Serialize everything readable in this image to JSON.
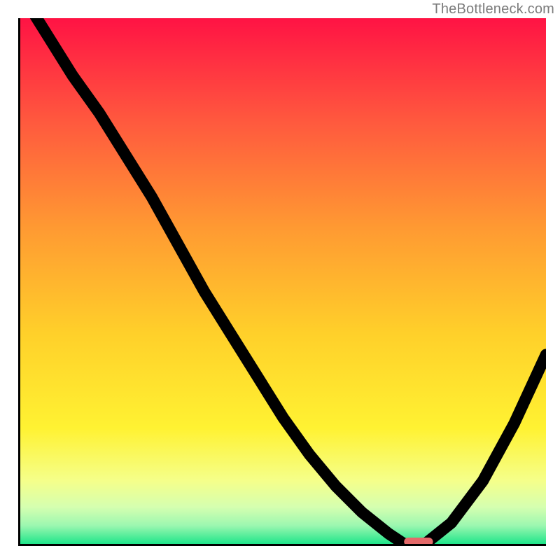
{
  "watermark": "TheBottleneck.com",
  "colors": {
    "axis": "#000000",
    "curve": "#000000",
    "marker": "#e56a6a",
    "gradient_stops": [
      {
        "offset": 0.0,
        "color": "#ff1344"
      },
      {
        "offset": 0.2,
        "color": "#ff5a3e"
      },
      {
        "offset": 0.4,
        "color": "#ff9a32"
      },
      {
        "offset": 0.6,
        "color": "#ffd02a"
      },
      {
        "offset": 0.78,
        "color": "#fff232"
      },
      {
        "offset": 0.88,
        "color": "#f5ff8a"
      },
      {
        "offset": 0.93,
        "color": "#d5ffb0"
      },
      {
        "offset": 0.965,
        "color": "#9cf7b0"
      },
      {
        "offset": 1.0,
        "color": "#1fe58a"
      }
    ]
  },
  "chart_data": {
    "type": "line",
    "title": "",
    "xlabel": "",
    "ylabel": "",
    "xlim": [
      0,
      100
    ],
    "ylim": [
      0,
      100
    ],
    "x": [
      0,
      5,
      10,
      15,
      20,
      25,
      30,
      35,
      40,
      45,
      50,
      55,
      60,
      65,
      70,
      73,
      77,
      82,
      88,
      94,
      100
    ],
    "values": [
      105,
      97,
      89,
      82,
      74,
      66,
      57,
      48,
      40,
      32,
      24,
      17,
      11,
      6,
      2,
      0,
      0,
      4,
      12,
      23,
      36
    ],
    "marker": {
      "x_range": [
        73,
        78.5
      ],
      "y": 0
    },
    "notes": "Values are percent of y-axis height; curve descends from top-left, flattens at zero near x≈73–77, then rises toward the right edge."
  }
}
